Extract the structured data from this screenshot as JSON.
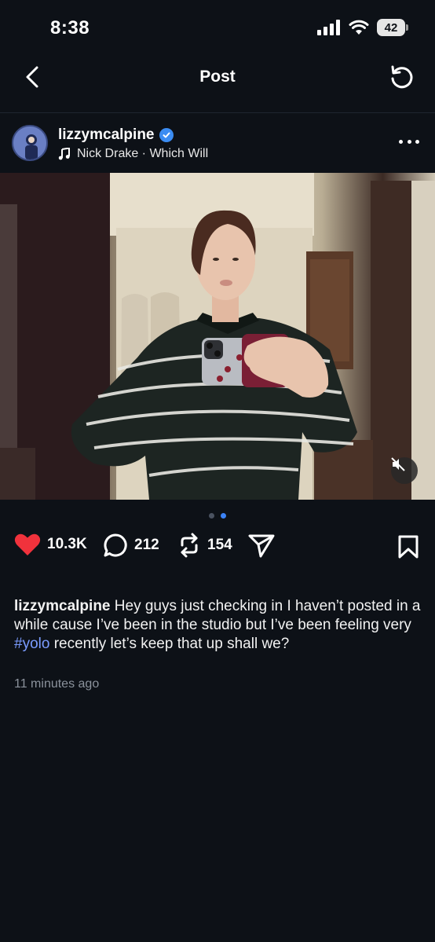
{
  "status": {
    "time": "8:38",
    "battery": "42"
  },
  "nav": {
    "title": "Post"
  },
  "post": {
    "username": "lizzymcalpine",
    "music": "Nick Drake · Which Will",
    "stats": {
      "likes": "10.3K",
      "comments": "212",
      "reposts": "154"
    },
    "carousel": {
      "count": 2,
      "active_index": 1
    },
    "caption": {
      "username": "lizzymcalpine",
      "text_before": "Hey guys just checking in I haven’t posted in a while cause I’ve been in the studio but I’ve been feeling very",
      "hashtag": "#yolo",
      "text_after": "recently let’s keep that up shall we?"
    },
    "timestamp": "11 minutes ago"
  },
  "colors": {
    "accent": "#3b82f6",
    "like": "#f0323c",
    "hashtag": "#7b9cff",
    "verified": "#3b8cf2"
  }
}
